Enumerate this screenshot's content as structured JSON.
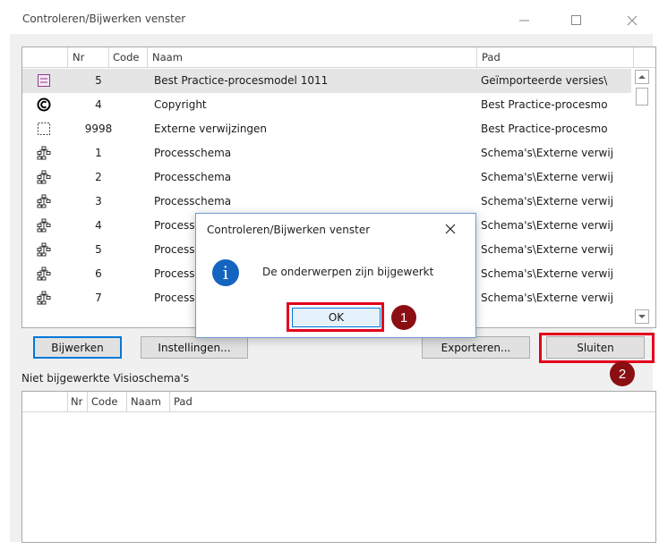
{
  "window": {
    "title": "Controleren/Bijwerken venster"
  },
  "list": {
    "columns": [
      "Nr",
      "Code",
      "Naam",
      "Pad"
    ],
    "rows": [
      {
        "icon": "process-model-icon",
        "nr": "5",
        "name": "Best Practice-procesmodel 1011",
        "path": "Geïmporteerde versies\\",
        "selected": true
      },
      {
        "icon": "copyright-icon",
        "nr": "4",
        "name": "Copyright",
        "path": "Best Practice-procesmo"
      },
      {
        "icon": "external-reference-icon",
        "nr": "9998",
        "name": "Externe verwijzingen",
        "path": "Best Practice-procesmo"
      },
      {
        "icon": "process-schema-icon",
        "nr": "1",
        "name": "Processchema",
        "path": "Schema's\\Externe verwij"
      },
      {
        "icon": "process-schema-icon",
        "nr": "2",
        "name": "Processchema",
        "path": "Schema's\\Externe verwij"
      },
      {
        "icon": "process-schema-icon",
        "nr": "3",
        "name": "Processchema",
        "path": "Schema's\\Externe verwij"
      },
      {
        "icon": "process-schema-icon",
        "nr": "4",
        "name": "Process",
        "path": "Schema's\\Externe verwij"
      },
      {
        "icon": "process-schema-icon",
        "nr": "5",
        "name": "Process",
        "path": "Schema's\\Externe verwij"
      },
      {
        "icon": "process-schema-icon",
        "nr": "6",
        "name": "Process",
        "path": "Schema's\\Externe verwij"
      },
      {
        "icon": "process-schema-icon",
        "nr": "7",
        "name": "Process",
        "path": "Schema's\\Externe verwij"
      }
    ]
  },
  "buttons": {
    "update": "Bijwerken",
    "settings": "Instellingen...",
    "export": "Exporteren...",
    "close": "Sluiten"
  },
  "second_list": {
    "label": "Niet bijgewerkte Visioschema's",
    "columns": [
      "Nr",
      "Code",
      "Naam",
      "Pad"
    ]
  },
  "dialog": {
    "title": "Controleren/Bijwerken venster",
    "message": "De onderwerpen zijn bijgewerkt",
    "ok": "OK",
    "info_glyph": "i"
  },
  "annotations": {
    "step1": "1",
    "step2": "2",
    "highlight_color": "#e3001b",
    "badge_color": "#8b0e12"
  }
}
